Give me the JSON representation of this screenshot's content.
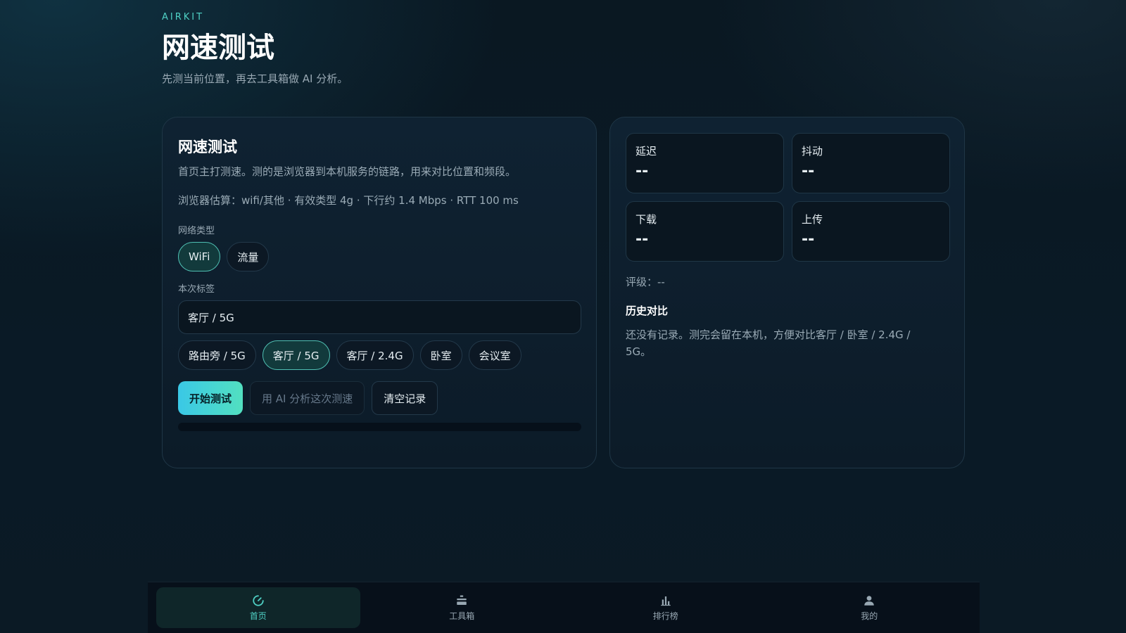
{
  "header": {
    "brand": "AIRKIT",
    "title": "网速测试",
    "subtitle": "先测当前位置，再去工具箱做 AI 分析。"
  },
  "test_card": {
    "title": "网速测试",
    "description": "首页主打测速。测的是浏览器到本机服务的链路，用来对比位置和频段。",
    "estimate": "浏览器估算：wifi/其他 · 有效类型 4g · 下行约 1.4 Mbps · RTT 100 ms",
    "network_type_label": "网络类型",
    "network_types": [
      {
        "label": "WiFi",
        "active": true
      },
      {
        "label": "流量",
        "active": false
      }
    ],
    "tag_label": "本次标签",
    "tag_value": "客厅 / 5G",
    "tag_presets": [
      {
        "label": "路由旁 / 5G",
        "active": false
      },
      {
        "label": "客厅 / 5G",
        "active": true
      },
      {
        "label": "客厅 / 2.4G",
        "active": false
      },
      {
        "label": "卧室",
        "active": false
      },
      {
        "label": "会议室",
        "active": false
      }
    ],
    "start_button": "开始测试",
    "ai_button": "用 AI 分析这次测速",
    "clear_button": "清空记录",
    "progress": 0
  },
  "results_card": {
    "metrics": [
      {
        "label": "延迟",
        "value": "--"
      },
      {
        "label": "抖动",
        "value": "--"
      },
      {
        "label": "下载",
        "value": "--"
      },
      {
        "label": "上传",
        "value": "--"
      }
    ],
    "rating": "评级：--",
    "history_title": "历史对比",
    "history_text": "还没有记录。测完会留在本机，方便对比客厅 / 卧室 / 2.4G / 5G。"
  },
  "nav": {
    "items": [
      {
        "label": "首页",
        "icon": "speed-gauge-icon",
        "active": true
      },
      {
        "label": "工具箱",
        "icon": "toolbox-icon",
        "active": false
      },
      {
        "label": "排行榜",
        "icon": "bar-chart-icon",
        "active": false
      },
      {
        "label": "我的",
        "icon": "user-icon",
        "active": false
      }
    ]
  },
  "colors": {
    "accent": "#4fd1c5",
    "primary_gradient_start": "#3ac8e6",
    "primary_gradient_end": "#52e0c0",
    "background": "#0a1822"
  }
}
